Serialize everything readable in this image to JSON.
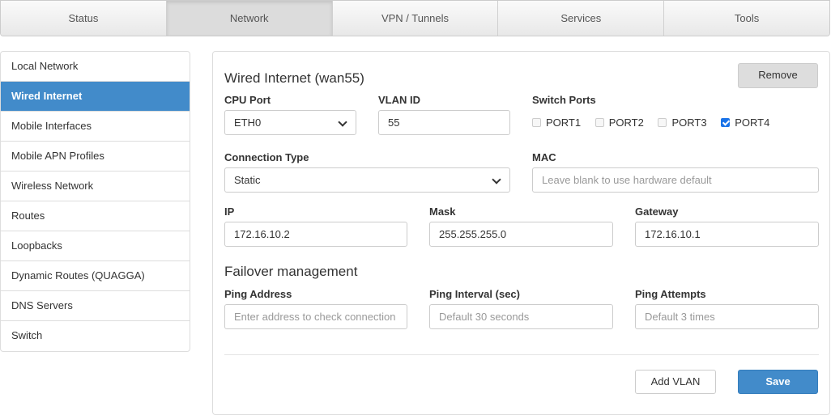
{
  "tabs": [
    {
      "label": "Status"
    },
    {
      "label": "Network"
    },
    {
      "label": "VPN / Tunnels"
    },
    {
      "label": "Services"
    },
    {
      "label": "Tools"
    }
  ],
  "sidebar": {
    "items": [
      {
        "label": "Local Network"
      },
      {
        "label": "Wired Internet"
      },
      {
        "label": "Mobile Interfaces"
      },
      {
        "label": "Mobile APN Profiles"
      },
      {
        "label": "Wireless Network"
      },
      {
        "label": "Routes"
      },
      {
        "label": "Loopbacks"
      },
      {
        "label": "Dynamic Routes (QUAGGA)"
      },
      {
        "label": "DNS Servers"
      },
      {
        "label": "Switch"
      }
    ]
  },
  "form": {
    "title": "Wired Internet (wan55)",
    "remove_label": "Remove",
    "cpu_port": {
      "label": "CPU Port",
      "value": "ETH0"
    },
    "vlan_id": {
      "label": "VLAN ID",
      "value": "55"
    },
    "switch_ports": {
      "label": "Switch Ports",
      "ports": [
        {
          "label": "PORT1",
          "checked": false
        },
        {
          "label": "PORT2",
          "checked": false
        },
        {
          "label": "PORT3",
          "checked": false
        },
        {
          "label": "PORT4",
          "checked": true
        }
      ]
    },
    "connection_type": {
      "label": "Connection Type",
      "value": "Static"
    },
    "mac": {
      "label": "MAC",
      "placeholder": "Leave blank to use hardware default"
    },
    "ip": {
      "label": "IP",
      "value": "172.16.10.2"
    },
    "mask": {
      "label": "Mask",
      "value": "255.255.255.0"
    },
    "gateway": {
      "label": "Gateway",
      "value": "172.16.10.1"
    },
    "failover_title": "Failover management",
    "ping_address": {
      "label": "Ping Address",
      "placeholder": "Enter address to check connection"
    },
    "ping_interval": {
      "label": "Ping Interval (sec)",
      "placeholder": "Default 30 seconds"
    },
    "ping_attempts": {
      "label": "Ping Attempts",
      "placeholder": "Default 3 times"
    },
    "add_vlan_label": "Add VLAN",
    "save_label": "Save"
  },
  "colors": {
    "accent": "#428bca"
  }
}
